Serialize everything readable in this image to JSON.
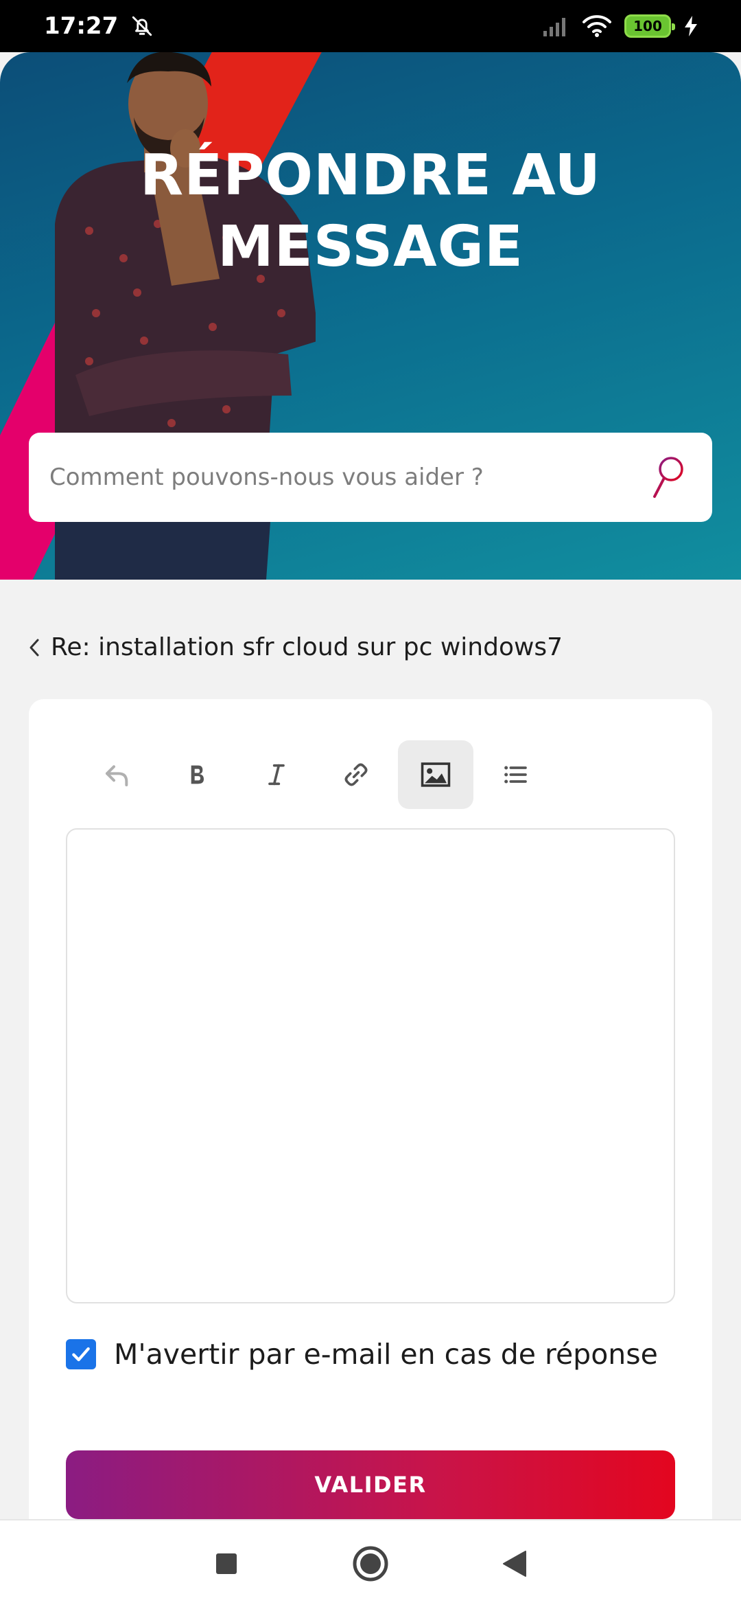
{
  "status_bar": {
    "time": "17:27",
    "battery": "100"
  },
  "hero": {
    "title_line1": "RÉPONDRE AU",
    "title_line2": "MESSAGE"
  },
  "search": {
    "placeholder": "Comment pouvons-nous vous aider ?"
  },
  "thread": {
    "title": "Re: installation sfr cloud sur pc windows7"
  },
  "toolbar": {
    "icons": [
      "undo-icon",
      "bold-icon",
      "italic-icon",
      "link-icon",
      "image-icon",
      "list-icon"
    ],
    "active": "image-icon"
  },
  "editor": {
    "value": ""
  },
  "notify": {
    "label": "M'avertir par e-mail en cas de réponse",
    "checked": true
  },
  "submit": {
    "label": "VALIDER"
  },
  "colors": {
    "brand_red": "#e2231a",
    "brand_pink": "#e4006b",
    "checkbox": "#1a73e8"
  }
}
